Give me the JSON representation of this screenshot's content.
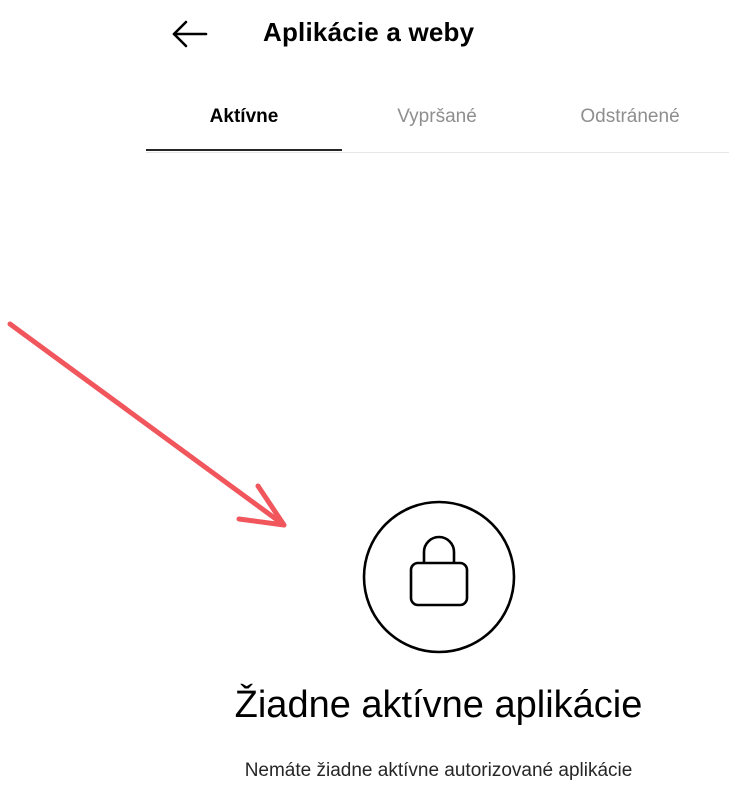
{
  "header": {
    "back_icon": "arrow-left-icon",
    "title": "Aplikácie a weby"
  },
  "tabs": [
    {
      "label": "Aktívne",
      "active": true
    },
    {
      "label": "Vypršané",
      "active": false
    },
    {
      "label": "Odstránené",
      "active": false
    }
  ],
  "annotation": {
    "icon": "red-arrow-annotation",
    "color": "#f0565c"
  },
  "empty_state": {
    "icon": "lock-icon",
    "title": "Žiadne aktívne aplikácie",
    "description": "Nemáte žiadne aktívne autorizované aplikácie"
  },
  "colors": {
    "active_tab": "#000000",
    "inactive_tab": "#8e8e8e",
    "underline": "#262626",
    "divider": "#e6e6e6"
  }
}
